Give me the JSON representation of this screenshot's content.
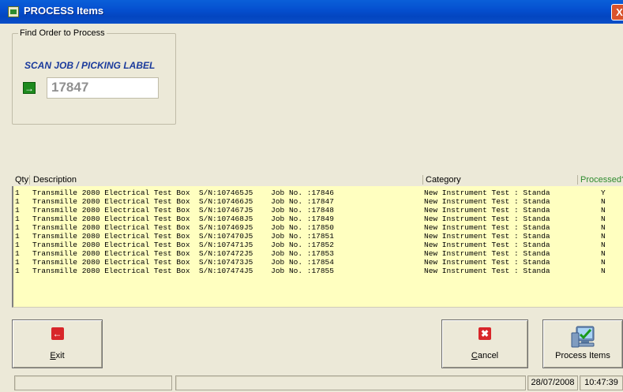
{
  "window": {
    "title": "PROCESS Items",
    "close_glyph": "X"
  },
  "find_group": {
    "legend": "Find Order to  Process",
    "scan_label": "SCAN JOB / PICKING LABEL",
    "go_icon_glyph": "→",
    "scan_value": "17847"
  },
  "grid": {
    "headers": {
      "qty": "Qty",
      "description": "Description",
      "category": "Category",
      "processed": "Processed?"
    },
    "rows": [
      {
        "qty": "1",
        "description": "Transmille 2080 Electrical Test Box  S/N:107465J5    Job No. :17846",
        "category": "New Instrument Test : Standa",
        "processed": "Y"
      },
      {
        "qty": "1",
        "description": "Transmille 2080 Electrical Test Box  S/N:107466J5    Job No. :17847",
        "category": "New Instrument Test : Standa",
        "processed": "N"
      },
      {
        "qty": "1",
        "description": "Transmille 2080 Electrical Test Box  S/N:107467J5    Job No. :17848",
        "category": "New Instrument Test : Standa",
        "processed": "N"
      },
      {
        "qty": "1",
        "description": "Transmille 2080 Electrical Test Box  S/N:107468J5    Job No. :17849",
        "category": "New Instrument Test : Standa",
        "processed": "N"
      },
      {
        "qty": "1",
        "description": "Transmille 2080 Electrical Test Box  S/N:107469J5    Job No. :17850",
        "category": "New Instrument Test : Standa",
        "processed": "N"
      },
      {
        "qty": "1",
        "description": "Transmille 2080 Electrical Test Box  S/N:107470J5    Job No. :17851",
        "category": "New Instrument Test : Standa",
        "processed": "N"
      },
      {
        "qty": "1",
        "description": "Transmille 2080 Electrical Test Box  S/N:107471J5    Job No. :17852",
        "category": "New Instrument Test : Standa",
        "processed": "N"
      },
      {
        "qty": "1",
        "description": "Transmille 2080 Electrical Test Box  S/N:107472J5    Job No. :17853",
        "category": "New Instrument Test : Standa",
        "processed": "N"
      },
      {
        "qty": "1",
        "description": "Transmille 2080 Electrical Test Box  S/N:107473J5    Job No. :17854",
        "category": "New Instrument Test : Standa",
        "processed": "N"
      },
      {
        "qty": "1",
        "description": "Transmille 2080 Electrical Test Box  S/N:107474J5    Job No. :17855",
        "category": "New Instrument Test : Standa",
        "processed": "N"
      }
    ]
  },
  "buttons": {
    "exit": {
      "label_first": "E",
      "label_rest": "xit",
      "icon": "back-arrow-icon",
      "glyph": "←"
    },
    "cancel": {
      "label_first": "C",
      "label_rest": "ancel",
      "icon": "cancel-x-icon",
      "glyph": "✖"
    },
    "process": {
      "label": "Process Items",
      "icon": "computer-check-icon"
    }
  },
  "statusbar": {
    "date": "28/07/2008",
    "time": "10:47:39"
  },
  "colors": {
    "grid_bg": "#ffffc0",
    "titlebar": "#0550d0",
    "scan_label": "#1a3a9c",
    "processed_header": "#2e8b2e"
  }
}
